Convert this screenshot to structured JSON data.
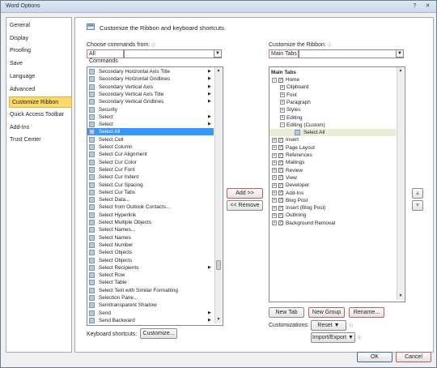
{
  "window": {
    "title": "Word Options",
    "help": "?",
    "close": "✕"
  },
  "nav": {
    "items": [
      "General",
      "Display",
      "Proofing",
      "Save",
      "Language",
      "Advanced",
      "Customize Ribbon",
      "Quick Access Toolbar",
      "Add-Ins",
      "Trust Center"
    ],
    "selected": "Customize Ribbon"
  },
  "header": {
    "text": "Customize the Ribbon and keyboard shortcuts."
  },
  "left": {
    "label": "Choose commands from:",
    "info": "ⓘ",
    "value": "All Commands",
    "commands": [
      {
        "label": "Secondary Horizontal Axis Title",
        "arrow": true
      },
      {
        "label": "Secondary Horizontal Gridlines",
        "arrow": true
      },
      {
        "label": "Secondary Vertical Axis",
        "arrow": true
      },
      {
        "label": "Secondary Vertical Axis Title",
        "arrow": true
      },
      {
        "label": "Secondary Vertical Gridlines",
        "arrow": true
      },
      {
        "label": "Security",
        "arrow": false
      },
      {
        "label": "Select",
        "arrow": true
      },
      {
        "label": "Select",
        "arrow": true
      },
      {
        "label": "Select All",
        "arrow": false
      },
      {
        "label": "Select Cell",
        "arrow": false
      },
      {
        "label": "Select Column",
        "arrow": false
      },
      {
        "label": "Select Cur Alignment",
        "arrow": false
      },
      {
        "label": "Select Cur Color",
        "arrow": false
      },
      {
        "label": "Select Cur Font",
        "arrow": false
      },
      {
        "label": "Select Cur Indent",
        "arrow": false
      },
      {
        "label": "Select Cur Spacing",
        "arrow": false
      },
      {
        "label": "Select Cur Tabs",
        "arrow": false
      },
      {
        "label": "Select Data...",
        "arrow": false
      },
      {
        "label": "Select from Outlook Contacts...",
        "arrow": false
      },
      {
        "label": "Select Hyperlink",
        "arrow": false
      },
      {
        "label": "Select Multiple Objects",
        "arrow": false
      },
      {
        "label": "Select Names...",
        "arrow": false
      },
      {
        "label": "Select Names",
        "arrow": false
      },
      {
        "label": "Select Number",
        "arrow": false
      },
      {
        "label": "Select Objects",
        "arrow": false
      },
      {
        "label": "Select Objects",
        "arrow": false
      },
      {
        "label": "Select Recipients",
        "arrow": true
      },
      {
        "label": "Select Row",
        "arrow": false
      },
      {
        "label": "Select Table",
        "arrow": false
      },
      {
        "label": "Select Text with Similar Formatting",
        "arrow": false
      },
      {
        "label": "Selection Pane...",
        "arrow": false
      },
      {
        "label": "Semitransparent Shadow",
        "arrow": false
      },
      {
        "label": "Send",
        "arrow": true
      },
      {
        "label": "Send Backward",
        "arrow": true
      }
    ],
    "selected_index": 8
  },
  "middle": {
    "add": "Add >>",
    "remove": "<< Remove"
  },
  "right": {
    "label": "Customize the Ribbon:",
    "info": "ⓘ",
    "value": "Main Tabs",
    "header": "Main Tabs",
    "items": [
      {
        "label": "Home",
        "level": 0,
        "exp": "minus",
        "check": true
      },
      {
        "label": "Clipboard",
        "level": 1,
        "exp": "plus",
        "check": false
      },
      {
        "label": "Font",
        "level": 1,
        "exp": "plus",
        "check": false
      },
      {
        "label": "Paragraph",
        "level": 1,
        "exp": "plus",
        "check": false
      },
      {
        "label": "Styles",
        "level": 1,
        "exp": "plus",
        "check": false
      },
      {
        "label": "Editing",
        "level": 1,
        "exp": "plus",
        "check": false
      },
      {
        "label": "Editing (Custom)",
        "level": 1,
        "exp": "minus",
        "check": false
      },
      {
        "label": "Select All",
        "level": 2,
        "exp": "none",
        "check": false
      },
      {
        "label": "Insert",
        "level": 0,
        "exp": "plus",
        "check": true
      },
      {
        "label": "Page Layout",
        "level": 0,
        "exp": "plus",
        "check": true
      },
      {
        "label": "References",
        "level": 0,
        "exp": "plus",
        "check": true
      },
      {
        "label": "Mailings",
        "level": 0,
        "exp": "plus",
        "check": true
      },
      {
        "label": "Review",
        "level": 0,
        "exp": "plus",
        "check": true
      },
      {
        "label": "View",
        "level": 0,
        "exp": "plus",
        "check": true
      },
      {
        "label": "Developer",
        "level": 0,
        "exp": "plus",
        "check": true
      },
      {
        "label": "Add-Ins",
        "level": 0,
        "exp": "plus",
        "check": true
      },
      {
        "label": "Blog Post",
        "level": 0,
        "exp": "plus",
        "check": true
      },
      {
        "label": "Insert (Blog Post)",
        "level": 0,
        "exp": "plus",
        "check": true
      },
      {
        "label": "Outlining",
        "level": 0,
        "exp": "plus",
        "check": true
      },
      {
        "label": "Background Removal",
        "level": 0,
        "exp": "plus",
        "check": true
      }
    ],
    "move_up": "▲",
    "move_down": "▼"
  },
  "bottom": {
    "new_tab": "New Tab",
    "new_group": "New Group",
    "rename": "Rename...",
    "customizations_label": "Customizations:",
    "reset": "Reset ▼",
    "import_export": "Import/Export ▼",
    "info": "ⓘ",
    "keyboard_label": "Keyboard shortcuts:",
    "customize": "Customize..."
  },
  "footer": {
    "ok": "OK",
    "cancel": "Cancel"
  },
  "colors": {
    "selection": "#3399ff",
    "nav_selected": "#fbd86b",
    "accent_border": "#c85a5a"
  }
}
